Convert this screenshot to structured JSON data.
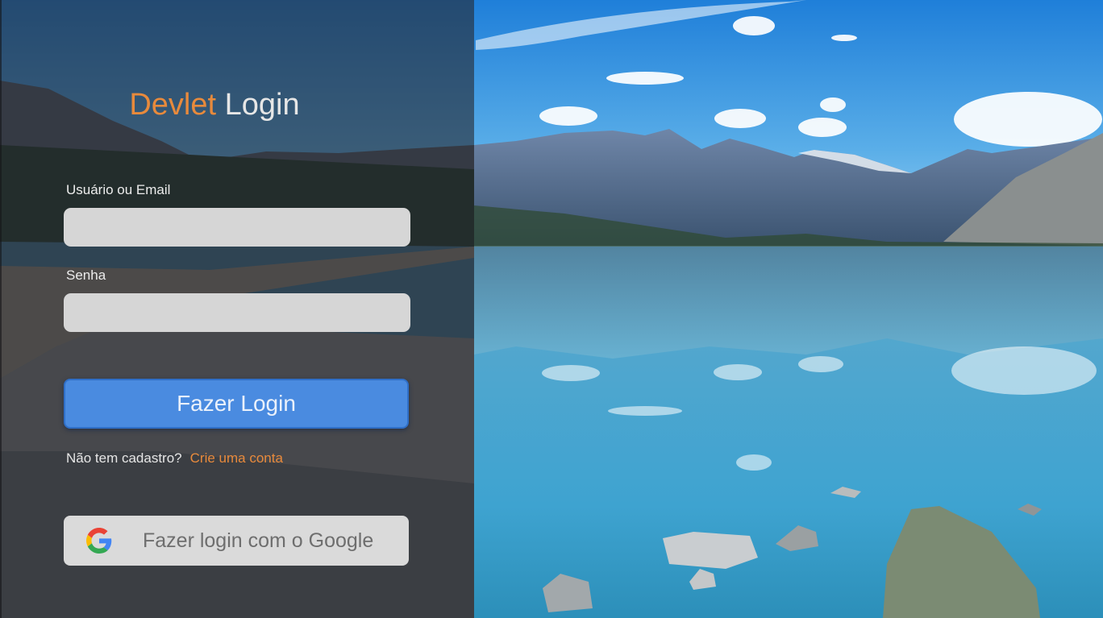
{
  "title": {
    "brand": "Devlet",
    "rest": "Login"
  },
  "username": {
    "label": "Usuário ou Email",
    "value": "",
    "placeholder": ""
  },
  "password": {
    "label": "Senha",
    "value": "",
    "placeholder": ""
  },
  "login_button": {
    "label": "Fazer Login"
  },
  "signup": {
    "question": "Não tem cadastro?",
    "link": "Crie uma conta"
  },
  "google_button": {
    "label": "Fazer login com o Google",
    "icon": "google-icon"
  },
  "colors": {
    "accent": "#e88a3c",
    "primary": "#4a8be0",
    "panel": "#262a32"
  }
}
